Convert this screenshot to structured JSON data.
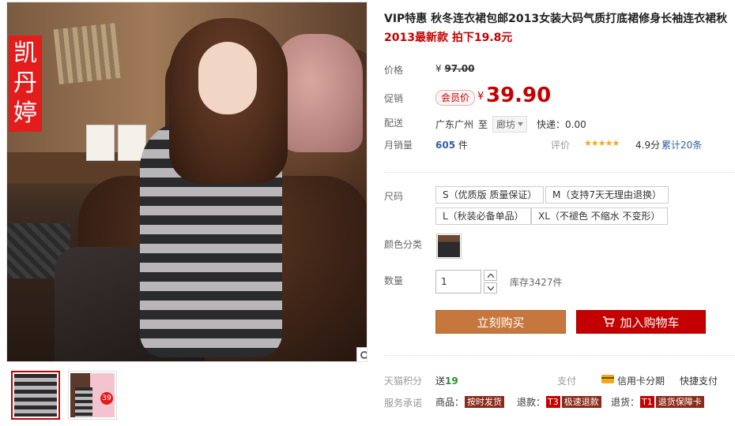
{
  "gallery": {
    "brand_chars": [
      "凯",
      "丹",
      "婷"
    ],
    "thumb_badge": "39"
  },
  "product": {
    "title": "VIP特惠 秋冬连衣裙包邮2013女装大码气质打底裙修身长袖连衣裙秋",
    "subtitle_year": "2013",
    "subtitle_rest": "最新款 拍下19.8元"
  },
  "price": {
    "label": "价格",
    "currency": "¥",
    "original": "97.00",
    "promo_label": "促销",
    "member_tag": "会员价",
    "current": "39.90"
  },
  "shipping": {
    "label": "配送",
    "origin": "广东广州",
    "to": "至",
    "destination": "廊坊",
    "fee": "快递：0.00"
  },
  "sales": {
    "label": "月销量",
    "count": "605",
    "unit": "件",
    "review_label": "评价",
    "stars": "★★★★★",
    "score": "4.9分",
    "review_count": "累计20条"
  },
  "size": {
    "label": "尺码",
    "options": [
      "S（优质版 质量保证）",
      "M（支持7天无理由退换）",
      "L（秋装必备单品）",
      "XL（不褪色 不缩水 不变形）"
    ]
  },
  "color": {
    "label": "颜色分类"
  },
  "quantity": {
    "label": "数量",
    "value": "1",
    "stock": "库存3427件"
  },
  "actions": {
    "buy_now": "立刻购买",
    "add_to_cart": "加入购物车"
  },
  "points": {
    "label": "天猫积分",
    "value_prefix": "送",
    "value": "19"
  },
  "payment": {
    "label": "支付",
    "credit": "信用卡分期",
    "quick": "快捷支付"
  },
  "service": {
    "label": "服务承诺",
    "goods_label": "商品：",
    "goods_tag": "按时发货",
    "refund_label": "退款：",
    "refund_code": "T3",
    "refund_tag": "极速退款",
    "return_label": "退货：",
    "return_code": "T1",
    "return_tag": "退货保障卡"
  },
  "icons": {
    "zoom": "magnifier-icon",
    "cart": "cart-icon",
    "chevron": "chevron-down-icon",
    "card": "credit-card-icon"
  },
  "colors": {
    "accent_red": "#c40000",
    "buy_now_bg": "#c5773d",
    "link_blue": "#2f5fa5",
    "star": "#f0a81c"
  }
}
